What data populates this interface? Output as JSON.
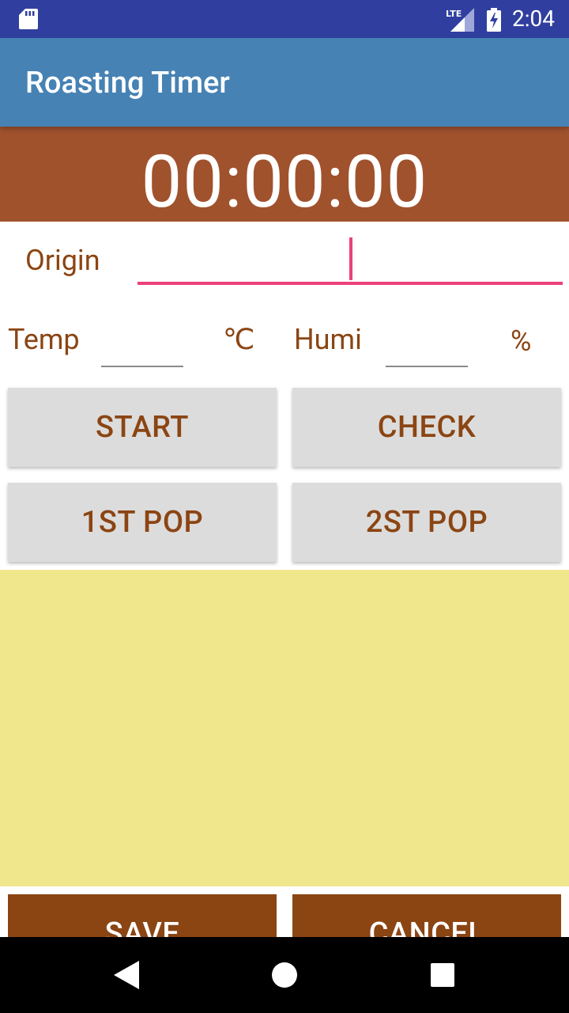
{
  "status_bar": {
    "time": "2:04",
    "network_label": "LTE",
    "icons": [
      "sd-card-icon",
      "lte-signal-icon",
      "battery-charging-icon"
    ]
  },
  "app_bar": {
    "title": "Roasting Timer"
  },
  "timer": {
    "display": "00:00:00"
  },
  "form": {
    "origin": {
      "label": "Origin",
      "value": "",
      "placeholder": ""
    },
    "temp": {
      "label": "Temp",
      "value": "",
      "unit": "℃"
    },
    "humi": {
      "label": "Humi",
      "value": "",
      "unit": "%"
    }
  },
  "buttons": {
    "start": "START",
    "check": "CHECK",
    "first_pop": "1ST POP",
    "second_pop": "2ST POP",
    "save": "SAVE",
    "cancel": "CANCEL"
  },
  "colors": {
    "status_bar": "#303f9f",
    "app_bar": "#4682b4",
    "timer_panel": "#a0522d",
    "label_text": "#8b4513",
    "accent": "#ec407a",
    "button_bg": "#dcdcdc",
    "log_area": "#f0e68c",
    "dark_button": "#8b4513"
  },
  "nav_bar": {
    "icons": [
      "back-icon",
      "home-icon",
      "recents-icon"
    ]
  }
}
